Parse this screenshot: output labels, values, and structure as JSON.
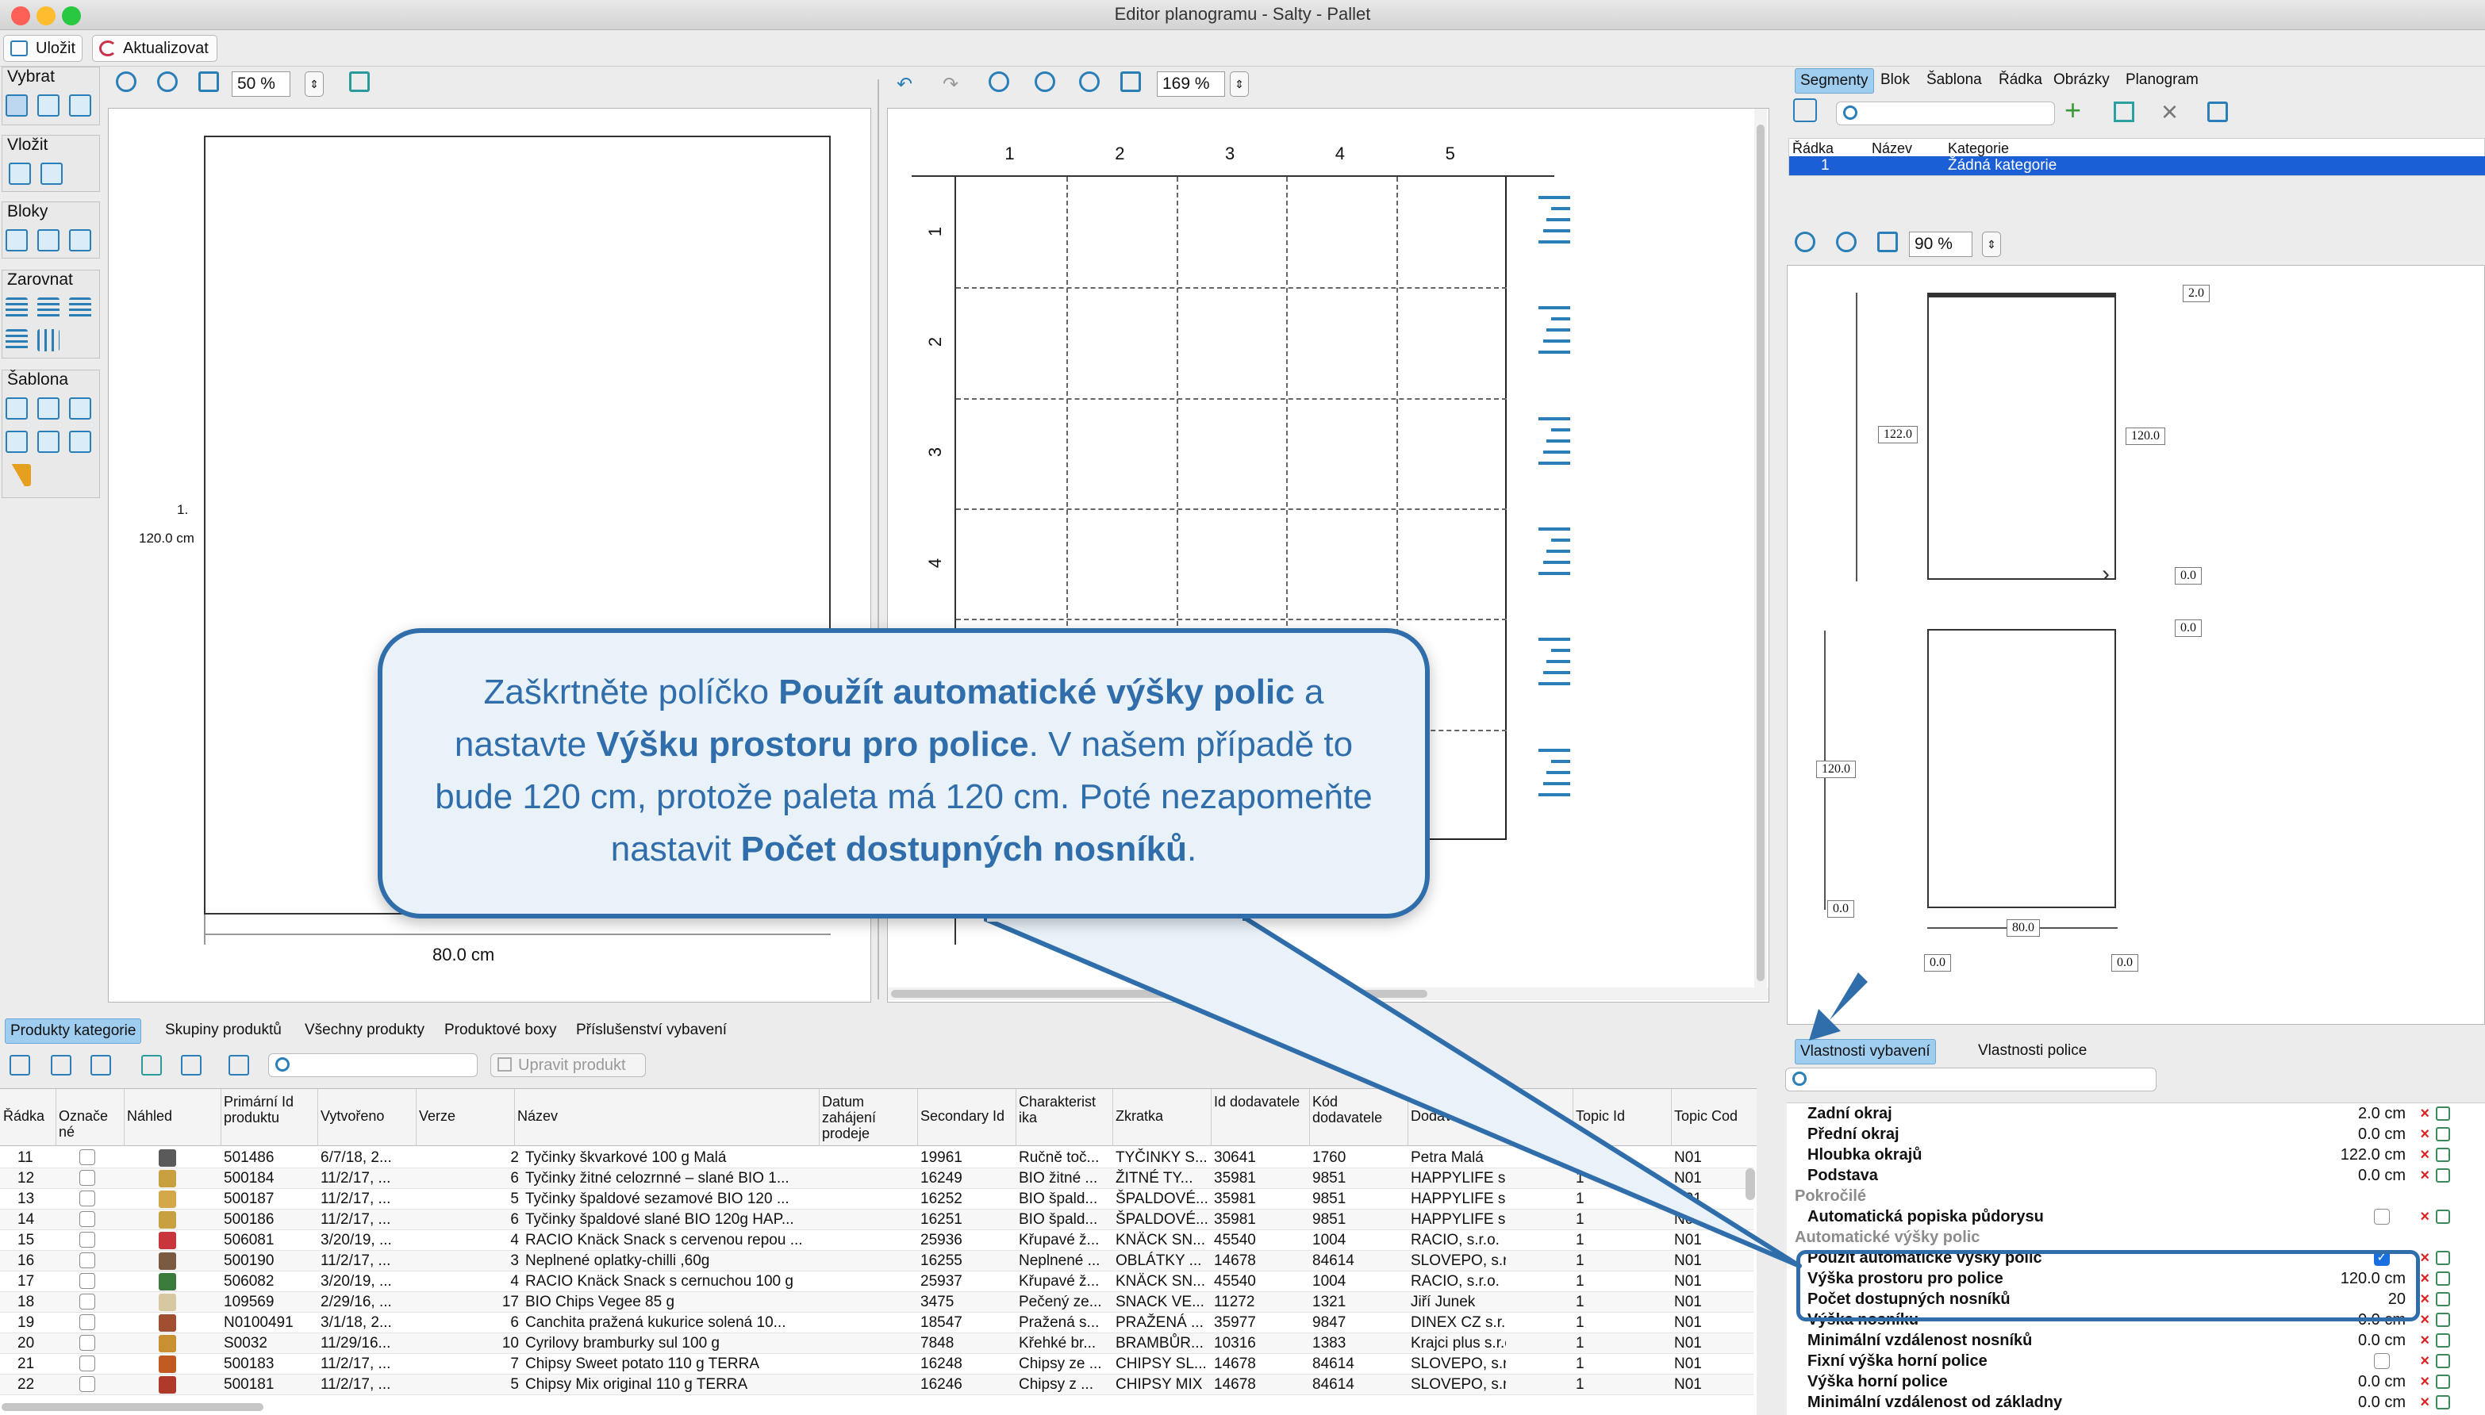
{
  "window": {
    "title": "Editor planogramu - Salty - Pallet"
  },
  "toolbar": {
    "save": "Uložit",
    "refresh": "Aktualizovat"
  },
  "side_toolbar": {
    "groups": [
      "Vybrat",
      "Vložit",
      "Bloky",
      "Zarovnat",
      "Šablona"
    ]
  },
  "left_canvas": {
    "zoom": "50 %",
    "row_label": "1.",
    "height_label": "120.0 cm",
    "width_label": "80.0 cm"
  },
  "middle_canvas": {
    "zoom": "169 %",
    "cols": [
      "1",
      "2",
      "3",
      "4",
      "5"
    ],
    "rows": [
      "1",
      "2",
      "3",
      "4"
    ]
  },
  "right_panel": {
    "tabs": [
      "Segmenty",
      "Blok",
      "Šablona",
      "Řádka",
      "Obrázky",
      "Planogram"
    ],
    "active_tab": "Segmenty",
    "table_headers": [
      "Řádka",
      "Název",
      "Kategorie"
    ],
    "table_row": {
      "row": "1",
      "name": "",
      "category": "Žádná kategorie"
    },
    "zoom": "90 %",
    "dims": {
      "top": "2.0",
      "left_h": "122.0",
      "right_h": "120.0",
      "mid": "0.0",
      "mid2": "0.0",
      "lower_h": "120.0",
      "lower_left": "0.0",
      "width": "80.0",
      "b1": "0.0",
      "b2": "0.0"
    }
  },
  "bottom_tabs": [
    "Produkty kategorie",
    "Skupiny produktů",
    "Všechny produkty",
    "Produktové boxy",
    "Příslušenství vybavení"
  ],
  "edit_product": "Upravit produkt",
  "product_table": {
    "headers": [
      "Řádka",
      "Označe né",
      "Náhled",
      "Primární Id produktu",
      "Vytvořeno",
      "Verze",
      "Název",
      "Datum zahájení prodeje",
      "Secondary Id",
      "Charakterist ika",
      "Zkratka",
      "Id dodavatele",
      "Kód dodavatele",
      "Dodav",
      "Topic Id",
      "Topic Cod"
    ],
    "rows": [
      [
        "11",
        "501486",
        "6/7/18, 2...",
        "2",
        "Tyčinky škvarkové 100 g Malá",
        "19961",
        "Ručně toč...",
        "TYČINKY S...",
        "30641",
        "1760",
        "Petra Malá",
        "1",
        "N01"
      ],
      [
        "12",
        "500184",
        "11/2/17, ...",
        "6",
        "Tyčinky žitné celozrnné – slané BIO 1...",
        "16249",
        "BIO žitné ...",
        "ŽITNÉ TY...",
        "35981",
        "9851",
        "HAPPYLIFE s.r.o.",
        "1",
        "N01"
      ],
      [
        "13",
        "500187",
        "11/2/17, ...",
        "5",
        "Tyčinky špaldové sezamové BIO 120 ...",
        "16252",
        "BIO špald...",
        "ŠPALDOVÉ...",
        "35981",
        "9851",
        "HAPPYLIFE s.r.o.",
        "1",
        "N01"
      ],
      [
        "14",
        "500186",
        "11/2/17, ...",
        "6",
        "Tyčinky špaldové slané BIO 120g HAP...",
        "16251",
        "BIO špald...",
        "ŠPALDOVÉ...",
        "35981",
        "9851",
        "HAPPYLIFE s.r.o.",
        "1",
        "N01"
      ],
      [
        "15",
        "506081",
        "3/20/19, ...",
        "4",
        "RACIO Knäck Snack s cervenou repou ...",
        "25936",
        "Křupavé ž...",
        "KNÄCK SN...",
        "45540",
        "1004",
        "RACIO, s.r.o.",
        "1",
        "N01"
      ],
      [
        "16",
        "500190",
        "11/2/17, ...",
        "3",
        "Neplnené oplatky-chilli ,60g",
        "16255",
        "Neplnené ...",
        "OBLÁTKY ...",
        "14678",
        "84614",
        "SLOVEPO, s.r.o.",
        "1",
        "N01"
      ],
      [
        "17",
        "506082",
        "3/20/19, ...",
        "4",
        "RACIO Knäck Snack s cernuchou 100 g",
        "25937",
        "Křupavé ž...",
        "KNÄCK SN...",
        "45540",
        "1004",
        "RACIO, s.r.o.",
        "1",
        "N01"
      ],
      [
        "18",
        "109569",
        "2/29/16, ...",
        "17",
        "BIO Chips Vegee 85 g",
        "3475",
        "Pečený ze...",
        "SNACK VE...",
        "11272",
        "1321",
        "Jiří Junek",
        "1",
        "N01"
      ],
      [
        "19",
        "N0100491",
        "3/1/18, 2...",
        "6",
        "Canchita pražená kukurice solená 10...",
        "18547",
        "Pražená s...",
        "PRAŽENÁ ...",
        "35977",
        "9847",
        "DINEX CZ s.r.o.",
        "1",
        "N01"
      ],
      [
        "20",
        "S0032",
        "11/29/16...",
        "10",
        "Cyrilovy bramburky sul 100 g",
        "7848",
        "Křehké br...",
        "BRAMBŮR...",
        "10316",
        "1383",
        "Krajci plus s.r.o.",
        "1",
        "N01"
      ],
      [
        "21",
        "500183",
        "11/2/17, ...",
        "7",
        "Chipsy Sweet potato 110 g TERRA",
        "16248",
        "Chipsy ze ...",
        "CHIPSY SL...",
        "14678",
        "84614",
        "SLOVEPO, s.r.o.",
        "1",
        "N01"
      ],
      [
        "22",
        "500181",
        "11/2/17, ...",
        "5",
        "Chipsy Mix original 110 g TERRA",
        "16246",
        "Chipsy z ...",
        "CHIPSY MIX",
        "14678",
        "84614",
        "SLOVEPO, s.r.o.",
        "1",
        "N01"
      ]
    ]
  },
  "props_tabs": [
    "Vlastnosti vybavení",
    "Vlastnosti police"
  ],
  "properties": [
    {
      "name": "Zadní okraj",
      "value": "2.0 cm"
    },
    {
      "name": "Přední okraj",
      "value": "0.0 cm"
    },
    {
      "name": "Hloubka okrajů",
      "value": "122.0 cm"
    },
    {
      "name": "Podstava",
      "value": "0.0 cm"
    }
  ],
  "prop_group_advanced": "Pokročilé",
  "prop_auto_label": "Automatická popiska půdorysu",
  "prop_group_auto": "Automatické výšky polic",
  "highlight_props": [
    {
      "name": "Použít automatické výšky polic",
      "value": ""
    },
    {
      "name": "Výška prostoru pro police",
      "value": "120.0 cm"
    },
    {
      "name": "Počet dostupných nosníků",
      "value": "20"
    }
  ],
  "more_props": [
    {
      "name": "Výška nosníku",
      "value": "0.0 cm"
    },
    {
      "name": "Minimální vzdálenost nosníků",
      "value": "0.0 cm"
    },
    {
      "name": "Fixní výška horní police",
      "value": ""
    },
    {
      "name": "Výška horní police",
      "value": "0.0 cm"
    },
    {
      "name": "Minimální vzdálenost od základny",
      "value": "0.0 cm"
    }
  ],
  "callout": {
    "p1": "Zaškrtněte políčko ",
    "b1": "Použít automatické výšky polic",
    "p2": " a nastavte ",
    "b2": "Výšku prostoru pro police",
    "p3": ". V našem případě to bude 120 cm, protože paleta má 120 cm. Poté nezapomeňte nastavit ",
    "b3": "Počet dostupných nosníků",
    "p4": "."
  },
  "colors": {
    "accent": "#2f6eaa",
    "selection": "#1a5fd6",
    "tab_active": "#9fcdef"
  }
}
